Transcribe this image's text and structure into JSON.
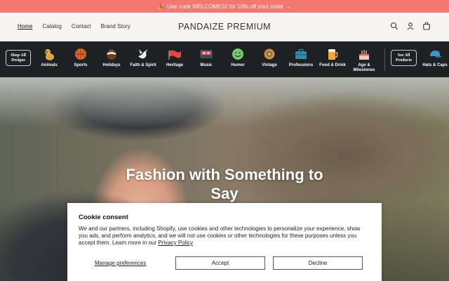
{
  "announcement": {
    "emoji": "🎉",
    "text": "Use code WELCOME10 for 10% off your order",
    "arrow": "→"
  },
  "header": {
    "nav": [
      "Home",
      "Catalog",
      "Contact",
      "Brand Story"
    ],
    "brand": "PANDAIZE PREMIUM",
    "icons": [
      "search-icon",
      "account-icon",
      "cart-icon"
    ]
  },
  "categories": {
    "shop_all": "Shop All Designs",
    "see_all": "See All Products",
    "items": [
      {
        "label": "Animals",
        "icon": "dog-icon"
      },
      {
        "label": "Sports",
        "icon": "basketball-icon"
      },
      {
        "label": "Holidays",
        "icon": "christmas-pudding-icon"
      },
      {
        "label": "Faith & Spirit",
        "icon": "dove-icon"
      },
      {
        "label": "Heritage",
        "icon": "flag-icon"
      },
      {
        "label": "Music",
        "icon": "cassette-icon"
      },
      {
        "label": "Humor",
        "icon": "smiley-icon"
      },
      {
        "label": "Vintage",
        "icon": "sun-badge-icon"
      },
      {
        "label": "Professions",
        "icon": "briefcase-icon"
      },
      {
        "label": "Food & Drink",
        "icon": "beer-mug-icon"
      },
      {
        "label": "Age & Milestones",
        "icon": "birthday-cake-icon"
      },
      {
        "label": "Hats & Caps",
        "icon": "cap-icon"
      }
    ]
  },
  "hero": {
    "title": "Fashion with Something to Say"
  },
  "cookie": {
    "title": "Cookie consent",
    "body": "We and our partners, including Shopify, use cookies and other technologies to personalize your experience, show you ads, and perform analytics, and we will not use cookies or other technologies for these purposes unless you accept them. Learn more in our ",
    "link": "Privacy Policy",
    "manage": "Manage preferences",
    "accept": "Accept",
    "decline": "Decline"
  },
  "colors": {
    "announcement_bg": "#f4786f",
    "category_bg": "#1e2124",
    "header_bg": "#f7f5f2"
  }
}
